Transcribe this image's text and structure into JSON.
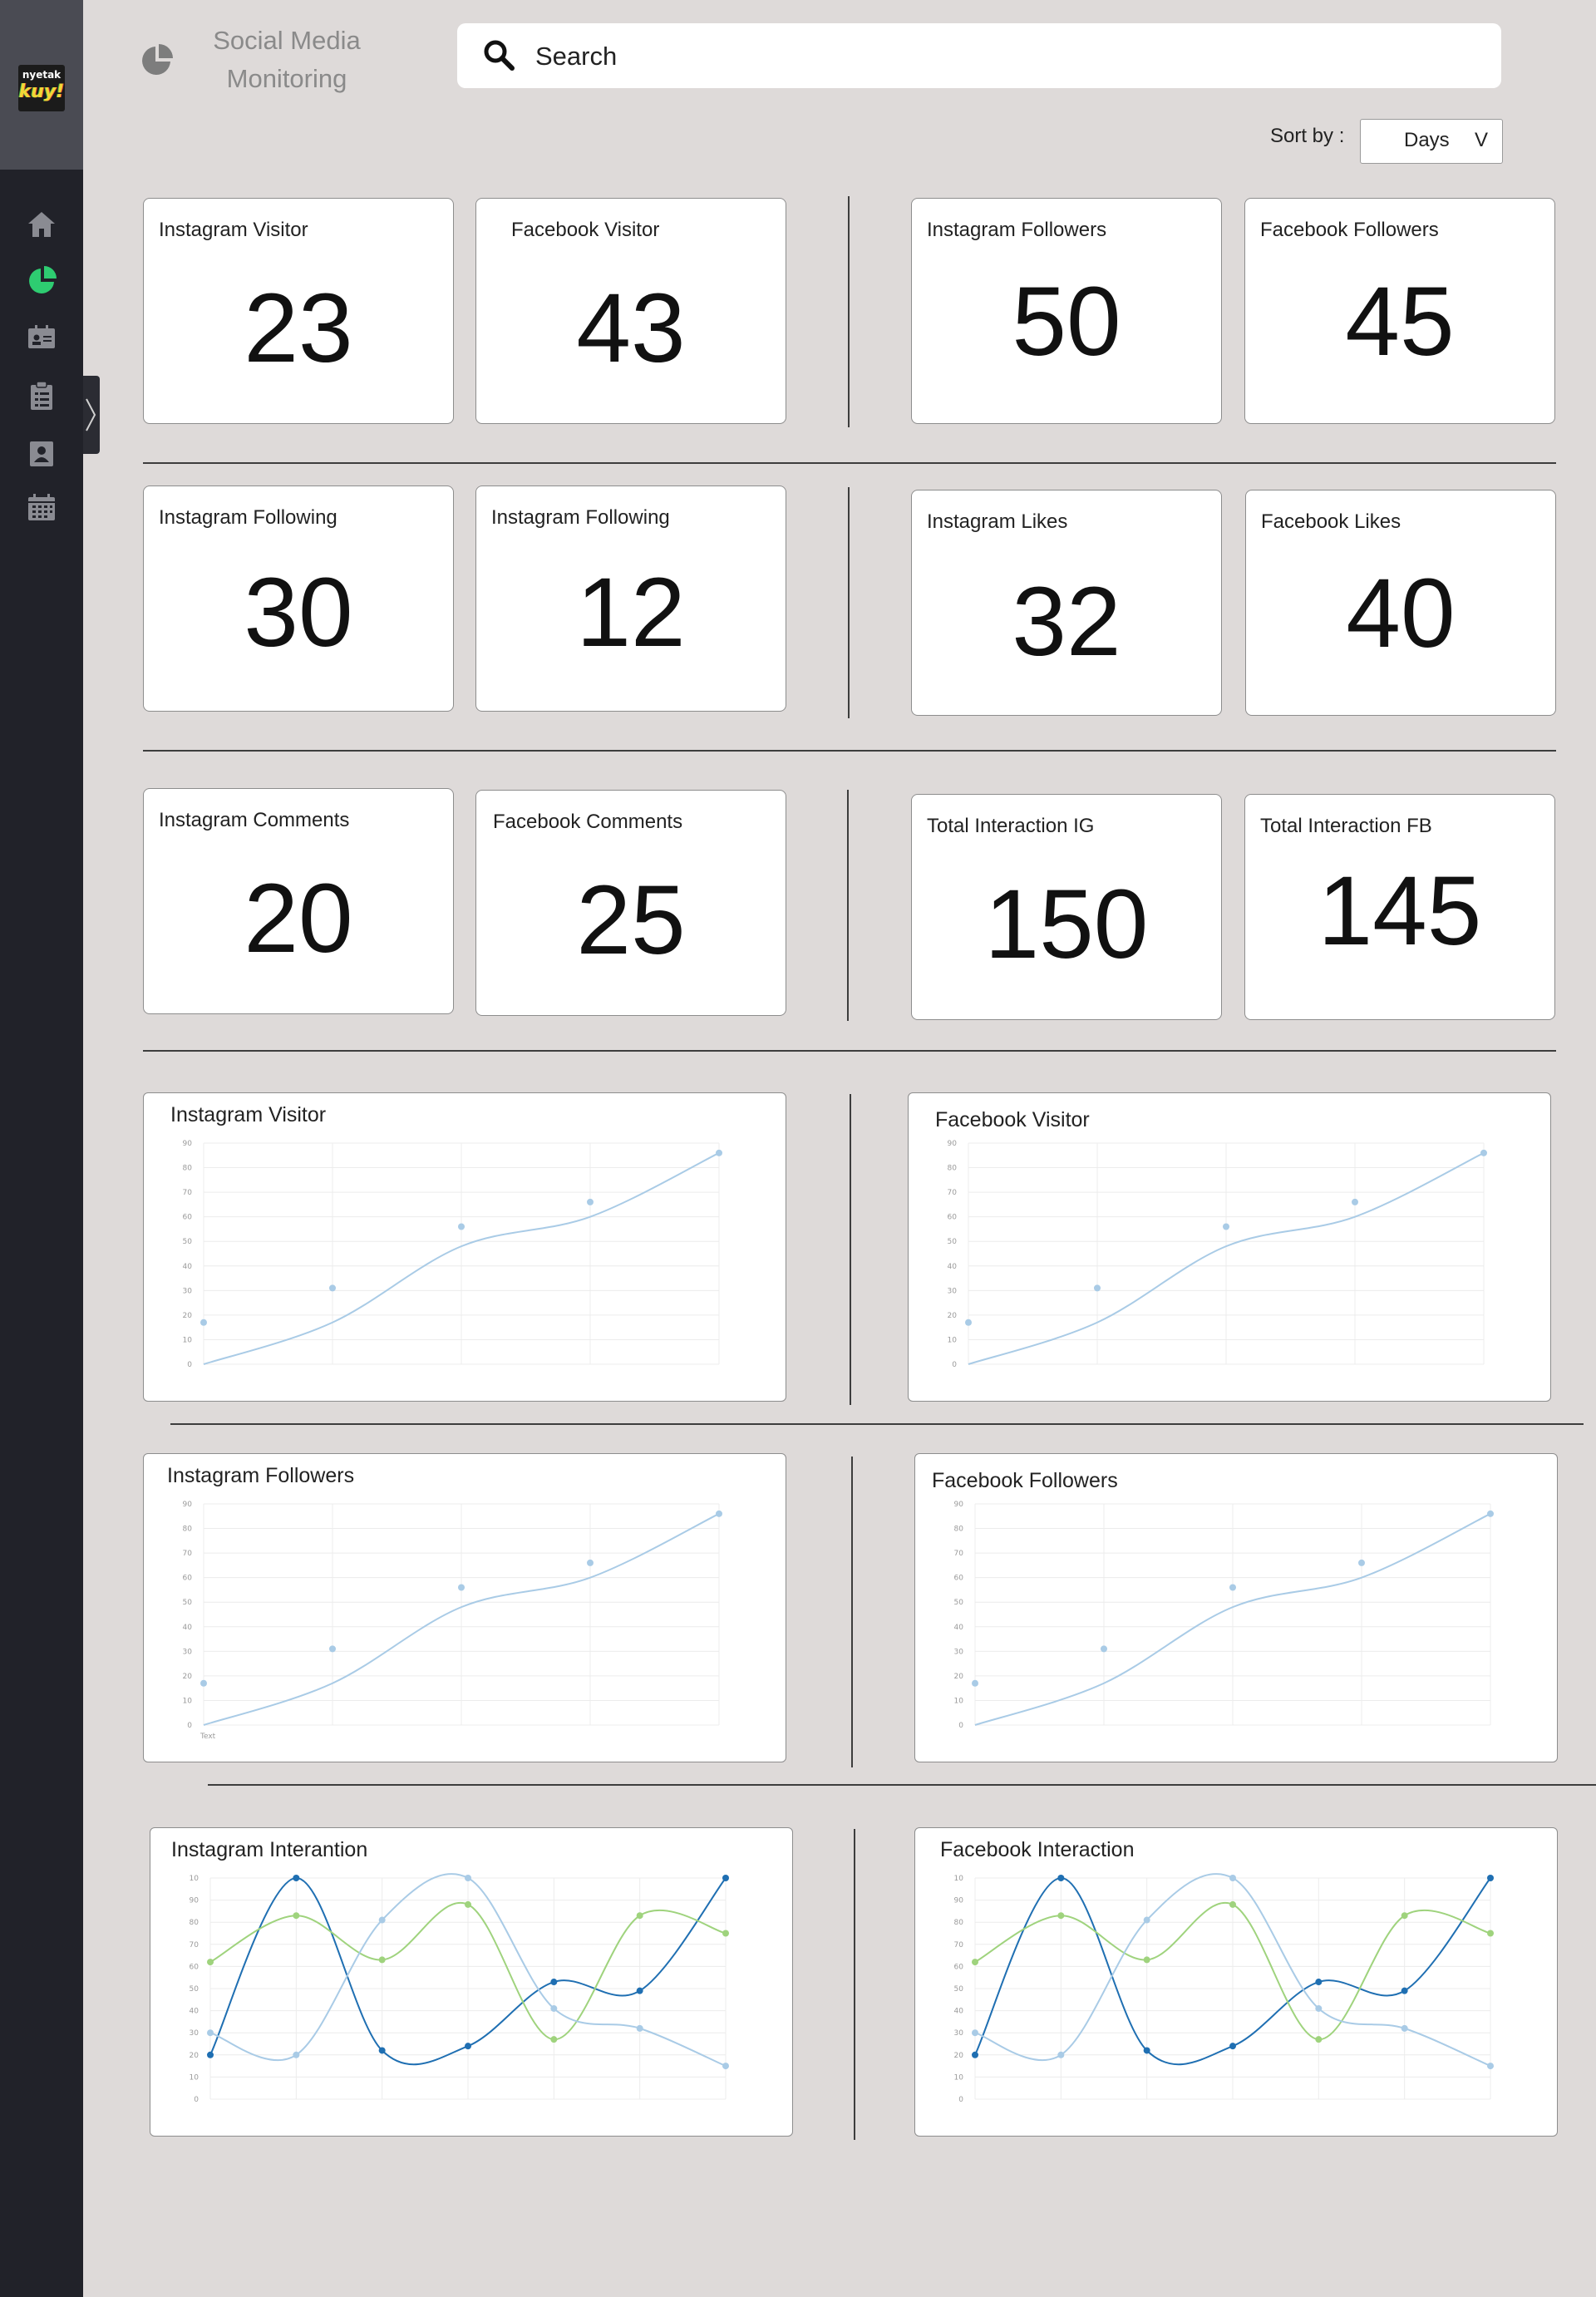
{
  "app": {
    "logo_text_top": "nyetak",
    "logo_text_bottom": "kuy!",
    "title": "Social Media Monitoring"
  },
  "sidebar": {
    "items": [
      {
        "icon": "home-icon"
      },
      {
        "icon": "pie-chart-icon",
        "active": true
      },
      {
        "icon": "id-card-icon"
      },
      {
        "icon": "clipboard-icon"
      },
      {
        "icon": "contact-icon"
      },
      {
        "icon": "calendar-icon"
      }
    ],
    "active_color": "#2ecc71"
  },
  "search": {
    "placeholder": "Search",
    "icon": "search-icon"
  },
  "sort": {
    "label": "Sort by :",
    "value": "Days",
    "arrow": "V"
  },
  "stats": [
    {
      "label": "Instagram Visitor",
      "value": "23"
    },
    {
      "label": "Facebook Visitor",
      "value": "43"
    },
    {
      "label": "Instagram Followers",
      "value": "50"
    },
    {
      "label": "Facebook Followers",
      "value": "45"
    },
    {
      "label": "Instagram Following",
      "value": "30"
    },
    {
      "label": "Instagram Following",
      "value": "12"
    },
    {
      "label": "Instagram Likes",
      "value": "32"
    },
    {
      "label": "Facebook Likes",
      "value": "40"
    },
    {
      "label": "Instagram Comments",
      "value": "20"
    },
    {
      "label": "Facebook Comments",
      "value": "25"
    },
    {
      "label": "Total Interaction IG",
      "value": "150"
    },
    {
      "label": "Total Interaction FB",
      "value": "145"
    }
  ],
  "panels": [
    {
      "title": "Instagram Visitor"
    },
    {
      "title": "Facebook Visitor"
    },
    {
      "title": "Instagram Followers"
    },
    {
      "title": "Facebook Followers"
    },
    {
      "title": "Instagram Interantion"
    },
    {
      "title": "Facebook Interaction"
    }
  ],
  "chart_data": [
    {
      "type": "line",
      "title": "Instagram Visitor",
      "x": [
        0,
        1,
        2,
        3,
        4
      ],
      "ylim": [
        0,
        90
      ],
      "y_ticks": [
        0,
        10,
        20,
        30,
        40,
        50,
        60,
        70,
        80,
        90
      ],
      "series": [
        {
          "values": [
            0,
            17,
            48,
            60,
            86
          ],
          "markers": [
            17,
            31,
            56,
            66,
            86
          ],
          "color": "#a9cbe6"
        }
      ]
    },
    {
      "type": "line",
      "title": "Facebook Visitor",
      "x": [
        0,
        1,
        2,
        3,
        4
      ],
      "ylim": [
        0,
        90
      ],
      "y_ticks": [
        0,
        10,
        20,
        30,
        40,
        50,
        60,
        70,
        80,
        90
      ],
      "series": [
        {
          "values": [
            0,
            17,
            48,
            60,
            86
          ],
          "markers": [
            17,
            31,
            56,
            66,
            86
          ],
          "color": "#a9cbe6"
        }
      ]
    },
    {
      "type": "line",
      "title": "Instagram Followers",
      "x": [
        0,
        1,
        2,
        3,
        4
      ],
      "x_tick_labels": [
        "Text"
      ],
      "ylim": [
        0,
        90
      ],
      "y_ticks": [
        0,
        10,
        20,
        30,
        40,
        50,
        60,
        70,
        80,
        90
      ],
      "series": [
        {
          "values": [
            0,
            17,
            48,
            60,
            86
          ],
          "markers": [
            17,
            31,
            56,
            66,
            86
          ],
          "color": "#a9cbe6"
        }
      ]
    },
    {
      "type": "line",
      "title": "Facebook Followers",
      "x": [
        0,
        1,
        2,
        3,
        4
      ],
      "ylim": [
        0,
        90
      ],
      "y_ticks": [
        0,
        10,
        20,
        30,
        40,
        50,
        60,
        70,
        80,
        90
      ],
      "series": [
        {
          "values": [
            0,
            17,
            48,
            60,
            86
          ],
          "markers": [
            17,
            31,
            56,
            66,
            86
          ],
          "color": "#a9cbe6"
        }
      ]
    },
    {
      "type": "line",
      "title": "Instagram Interantion",
      "x": [
        0,
        1,
        2,
        3,
        4,
        5,
        6
      ],
      "ylim": [
        0,
        100
      ],
      "y_ticks": [
        0,
        10,
        20,
        30,
        40,
        50,
        60,
        70,
        80,
        90,
        100
      ],
      "y_tick_labels": [
        "0",
        "10",
        "20",
        "30",
        "40",
        "50",
        "60",
        "70",
        "80",
        "90",
        "10"
      ],
      "series": [
        {
          "values": [
            20,
            100,
            22,
            24,
            53,
            49,
            100
          ],
          "color": "#1f6fb2"
        },
        {
          "values": [
            62,
            83,
            63,
            88,
            27,
            83,
            75
          ],
          "color": "#9fd37d"
        },
        {
          "values": [
            30,
            20,
            81,
            100,
            41,
            32,
            15
          ],
          "color": "#a9cbe6"
        }
      ]
    },
    {
      "type": "line",
      "title": "Facebook Interaction",
      "x": [
        0,
        1,
        2,
        3,
        4,
        5,
        6
      ],
      "ylim": [
        0,
        100
      ],
      "y_ticks": [
        0,
        10,
        20,
        30,
        40,
        50,
        60,
        70,
        80,
        90,
        100
      ],
      "y_tick_labels": [
        "0",
        "10",
        "20",
        "30",
        "40",
        "50",
        "60",
        "70",
        "80",
        "90",
        "10"
      ],
      "series": [
        {
          "values": [
            20,
            100,
            22,
            24,
            53,
            49,
            100
          ],
          "color": "#1f6fb2"
        },
        {
          "values": [
            62,
            83,
            63,
            88,
            27,
            83,
            75
          ],
          "color": "#9fd37d"
        },
        {
          "values": [
            30,
            20,
            81,
            100,
            41,
            32,
            15
          ],
          "color": "#a9cbe6"
        }
      ]
    }
  ]
}
